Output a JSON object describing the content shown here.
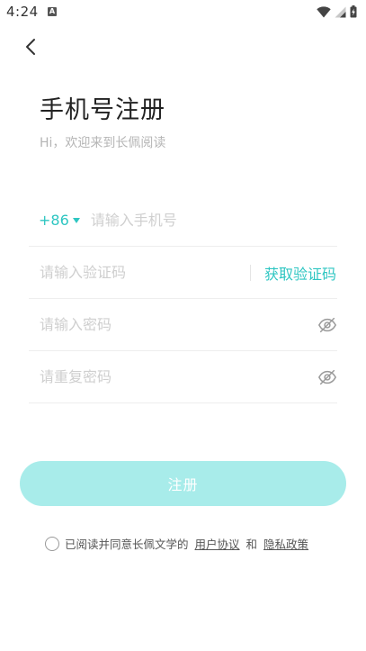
{
  "status_bar": {
    "time": "4:24",
    "notification_icon": "a-icon"
  },
  "header": {
    "back_icon": "chevron-left-icon",
    "title": "手机号注册",
    "subtitle": "Hi，欢迎来到长佩阅读"
  },
  "form": {
    "country_code": "+86",
    "phone_placeholder": "请输入手机号",
    "code_placeholder": "请输入验证码",
    "get_code_label": "获取验证码",
    "password_placeholder": "请输入密码",
    "confirm_password_placeholder": "请重复密码"
  },
  "register_button_label": "注册",
  "agreement": {
    "text": "已阅读并同意长佩文学的",
    "user_agreement": "用户协议",
    "and": "和",
    "privacy_policy": "隐私政策"
  },
  "colors": {
    "accent": "#2ec6c2",
    "button_disabled": "#a8ecea",
    "placeholder": "#cfcfcf"
  }
}
